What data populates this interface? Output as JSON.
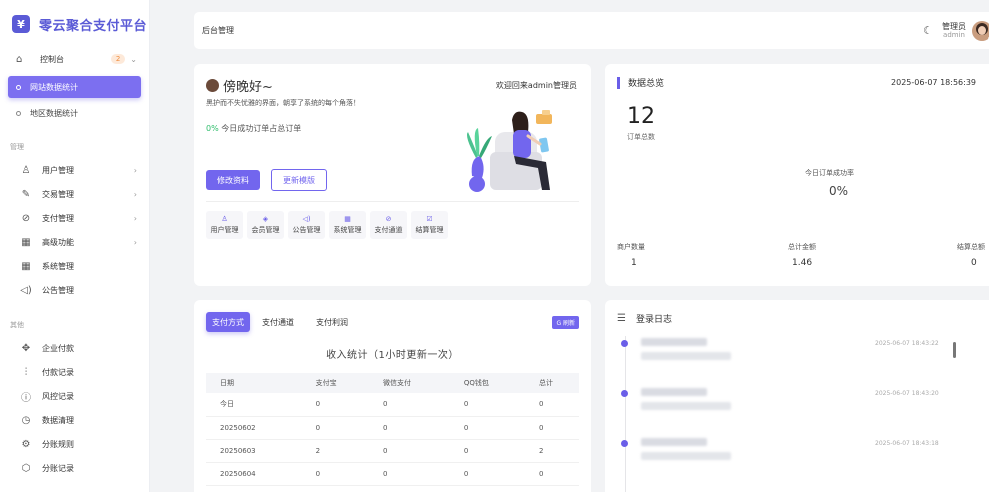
{
  "app": {
    "logo_glyph": "¥",
    "title": "零云聚合支付平台"
  },
  "sidebar": {
    "dashboard": {
      "label": "控制台",
      "badge": "2"
    },
    "dashboard_sub": [
      {
        "label": "网站数据统计",
        "active": true
      },
      {
        "label": "地区数据统计",
        "active": false
      }
    ],
    "section_manage": "管理",
    "manage_items": [
      {
        "label": "用户管理",
        "icon": "user-icon",
        "glyph": "♙",
        "expandable": true
      },
      {
        "label": "交易管理",
        "icon": "edit-icon",
        "glyph": "✎",
        "expandable": true
      },
      {
        "label": "支付管理",
        "icon": "check-circle-icon",
        "glyph": "⊘",
        "expandable": true
      },
      {
        "label": "高级功能",
        "icon": "grid-icon",
        "glyph": "▦",
        "expandable": true
      },
      {
        "label": "系统管理",
        "icon": "grid-icon",
        "glyph": "▦",
        "expandable": false
      },
      {
        "label": "公告管理",
        "icon": "speaker-icon",
        "glyph": "◁)",
        "expandable": false
      }
    ],
    "section_other": "其他",
    "other_items": [
      {
        "label": "企业付款",
        "icon": "cluster-icon",
        "glyph": "✥"
      },
      {
        "label": "付款记录",
        "icon": "sliders-icon",
        "glyph": "⫶"
      },
      {
        "label": "风控记录",
        "icon": "info-icon",
        "glyph": "ⓘ"
      },
      {
        "label": "数据清理",
        "icon": "clock-icon",
        "glyph": "◷"
      },
      {
        "label": "分账规则",
        "icon": "settings-icon",
        "glyph": "⚙"
      },
      {
        "label": "分账记录",
        "icon": "cube-icon",
        "glyph": "⬡"
      }
    ]
  },
  "header": {
    "breadcrumb": "后台管理",
    "admin_name": "管理员",
    "admin_sub": "admin"
  },
  "welcome": {
    "greeting": "傍晚好~",
    "motto": "黑护而不失忧雅的界面，朝享了系统的每个角落！",
    "right_title": "欢迎回来admin管理员",
    "rate_pct": "0%",
    "rate_text": "今日成功订单占总订单",
    "btn_edit": "修改资料",
    "btn_template": "更新模版",
    "quick": [
      {
        "label": "用户管理",
        "glyph": "♙",
        "icon": "user-icon"
      },
      {
        "label": "会员管理",
        "glyph": "◈",
        "icon": "vip-icon"
      },
      {
        "label": "公告管理",
        "glyph": "◁)",
        "icon": "speaker-icon"
      },
      {
        "label": "系统管理",
        "glyph": "▦",
        "icon": "grid-icon"
      },
      {
        "label": "支付通道",
        "glyph": "⊘",
        "icon": "check-circle-icon"
      },
      {
        "label": "结算管理",
        "glyph": "☑",
        "icon": "settle-icon"
      }
    ]
  },
  "overview": {
    "title": "数据总览",
    "time": "2025-06-07 18:56:39",
    "orders_total": "12",
    "orders_label": "订单总数",
    "success_rate_label": "今日订单成功率",
    "success_rate": "0%",
    "stats": [
      {
        "label": "商户数量",
        "value": "1"
      },
      {
        "label": "总计金额",
        "value": "1.46"
      },
      {
        "label": "结算总额",
        "value": "0"
      }
    ]
  },
  "income": {
    "tabs": [
      "支付方式",
      "支付通道",
      "支付利润"
    ],
    "refresh": "G 刷新",
    "title": "收入统计（1小时更新一次）",
    "columns": [
      "日期",
      "支付宝",
      "微信支付",
      "QQ钱包",
      "总计"
    ],
    "rows": [
      [
        "今日",
        "0",
        "0",
        "0",
        "0"
      ],
      [
        "20250602",
        "0",
        "0",
        "0",
        "0"
      ],
      [
        "20250603",
        "2",
        "0",
        "0",
        "2"
      ],
      [
        "20250604",
        "0",
        "0",
        "0",
        "0"
      ]
    ]
  },
  "log": {
    "title": "登录日志",
    "entries": [
      {
        "time": "2025-06-07 18:43:22"
      },
      {
        "time": "2025-06-07 18:43:20"
      },
      {
        "time": "2025-06-07 18:43:18"
      }
    ]
  },
  "colors": {
    "accent": "#7266ee",
    "success": "#2ebd6b",
    "badge": "#f08b3b"
  }
}
